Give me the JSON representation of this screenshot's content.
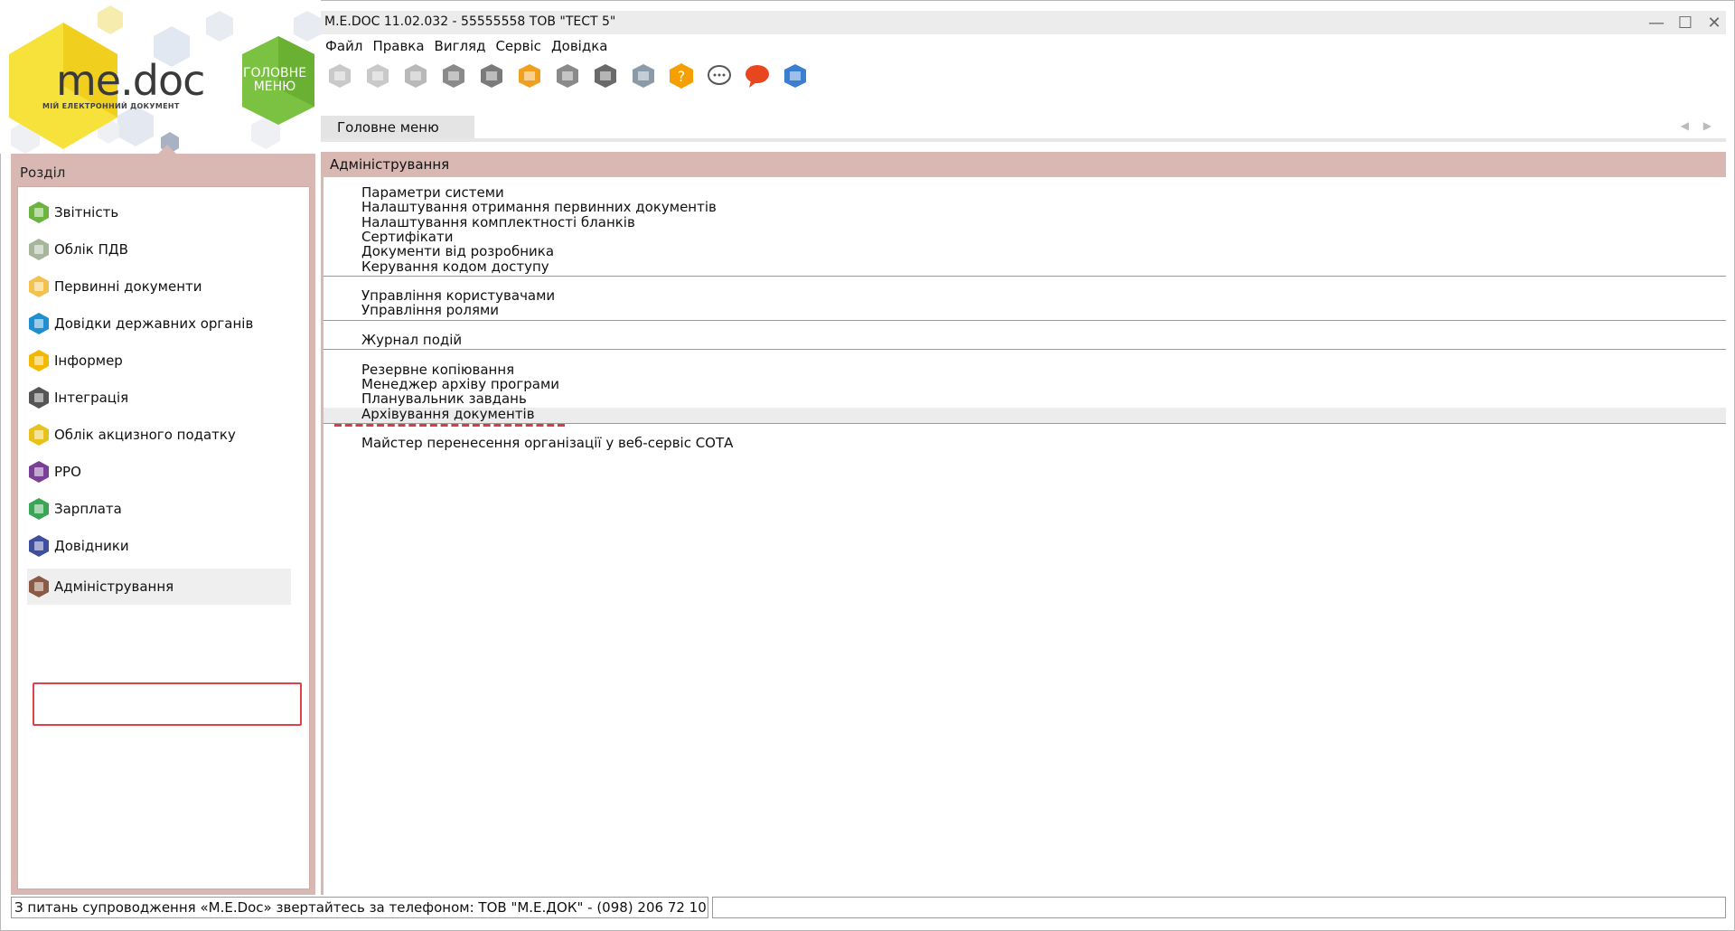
{
  "logo": {
    "brand_me": "me",
    "brand_doc": "doc",
    "tagline": "МІЙ ЕЛЕКТРОННИЙ ДОКУМЕНТ",
    "main_menu_line1": "ГОЛОВНЕ",
    "main_menu_line2": "МЕНЮ"
  },
  "window": {
    "title": "M.E.DOC 11.02.032  - 55555558 ТОВ \"ТЕСТ 5\""
  },
  "menubar": [
    "Файл",
    "Правка",
    "Вигляд",
    "Сервіс",
    "Довідка"
  ],
  "toolbar_icons": [
    "document-icon",
    "delete-document-icon",
    "copy-icon",
    "archive-icon",
    "print-icon",
    "send-icon",
    "search-document-icon",
    "inbox-icon",
    "check-icon",
    "help-icon",
    "chat-icon",
    "message-icon",
    "screen-icon"
  ],
  "tabs": {
    "active": "Головне меню"
  },
  "sidebar": {
    "header": "Розділ",
    "items": [
      {
        "label": "Звітність",
        "icon": "reports-icon",
        "color": "#6db33f"
      },
      {
        "label": "Облік ПДВ",
        "icon": "vat-icon",
        "color": "#a7b59a"
      },
      {
        "label": "Первинні документи",
        "icon": "primary-docs-icon",
        "color": "#f2c14e"
      },
      {
        "label": "Довідки державних органів",
        "icon": "government-icon",
        "color": "#1f8fcf"
      },
      {
        "label": "Інформер",
        "icon": "informer-icon",
        "color": "#f5b800"
      },
      {
        "label": "Інтеграція",
        "icon": "integration-icon",
        "color": "#555555"
      },
      {
        "label": "Облік акцизного податку",
        "icon": "excise-icon",
        "color": "#e8c21a"
      },
      {
        "label": "РРО",
        "icon": "cash-register-icon",
        "color": "#7b3f98"
      },
      {
        "label": "Зарплата",
        "icon": "salary-icon",
        "color": "#3aa655"
      },
      {
        "label": "Довідники",
        "icon": "directories-icon",
        "color": "#3f4f9e"
      },
      {
        "label": "Адміністрування",
        "icon": "administration-icon",
        "color": "#8a5a44",
        "selected": true
      }
    ]
  },
  "content": {
    "section_title": "Адміністрування",
    "groups": [
      [
        "Параметри системи",
        "Налаштування отримання первинних документів",
        "Налаштування комплектності бланків",
        "Сертифікати",
        "Документи від розробника",
        "Керування кодом доступу"
      ],
      [
        "Управління користувачами",
        "Управління ролями"
      ],
      [
        "Журнал подій"
      ],
      [
        "Резервне копіювання",
        "Менеджер архіву програми",
        "Планувальник завдань",
        "Архівування документів"
      ],
      [
        "Майстер перенесення організації у веб-сервіс СОТА"
      ]
    ]
  },
  "statusbar": {
    "text": "З питань супроводження «M.E.Doc» звертайтесь за телефоном: ТОВ \"М.Е.ДОК\" - (098) 206 72 10"
  }
}
